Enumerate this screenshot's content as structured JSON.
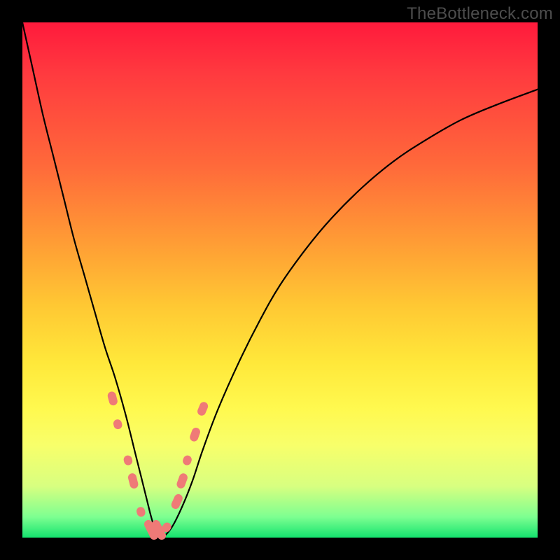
{
  "watermark": "TheBottleneck.com",
  "chart_data": {
    "type": "line",
    "title": "",
    "xlabel": "",
    "ylabel": "",
    "xlim": [
      0,
      100
    ],
    "ylim": [
      0,
      100
    ],
    "grid": false,
    "series": [
      {
        "name": "bottleneck-curve",
        "x": [
          0,
          2,
          4,
          6,
          8,
          10,
          12,
          14,
          16,
          18,
          20,
          22,
          23,
          24,
          25,
          26,
          27,
          29,
          31,
          33,
          35,
          38,
          42,
          46,
          50,
          55,
          60,
          66,
          72,
          78,
          85,
          92,
          100
        ],
        "y": [
          100,
          91,
          82,
          74,
          66,
          58,
          51,
          44,
          37,
          31,
          24,
          16,
          12,
          8,
          4,
          1,
          0,
          2,
          6,
          11,
          17,
          25,
          34,
          42,
          49,
          56,
          62,
          68,
          73,
          77,
          81,
          84,
          87
        ]
      }
    ],
    "overlay_points": {
      "name": "highlighted-samples",
      "color": "#ef7a77",
      "points": [
        {
          "x": 17.5,
          "y": 27,
          "r": 20
        },
        {
          "x": 18.5,
          "y": 22,
          "r": 14
        },
        {
          "x": 20.5,
          "y": 15,
          "r": 14
        },
        {
          "x": 21.5,
          "y": 11,
          "r": 22
        },
        {
          "x": 23,
          "y": 5,
          "r": 14
        },
        {
          "x": 25,
          "y": 1.5,
          "r": 30
        },
        {
          "x": 26.5,
          "y": 1.5,
          "r": 30
        },
        {
          "x": 28,
          "y": 2,
          "r": 14
        },
        {
          "x": 30,
          "y": 7,
          "r": 22
        },
        {
          "x": 31,
          "y": 11,
          "r": 22
        },
        {
          "x": 32,
          "y": 15,
          "r": 14
        },
        {
          "x": 33.5,
          "y": 20,
          "r": 20
        },
        {
          "x": 35,
          "y": 25,
          "r": 20
        }
      ]
    },
    "background_gradient": {
      "top": "#ff1a3c",
      "mid_upper": "#ff9a35",
      "mid": "#ffe83a",
      "mid_lower": "#d8ff80",
      "bottom": "#14e36e"
    }
  }
}
